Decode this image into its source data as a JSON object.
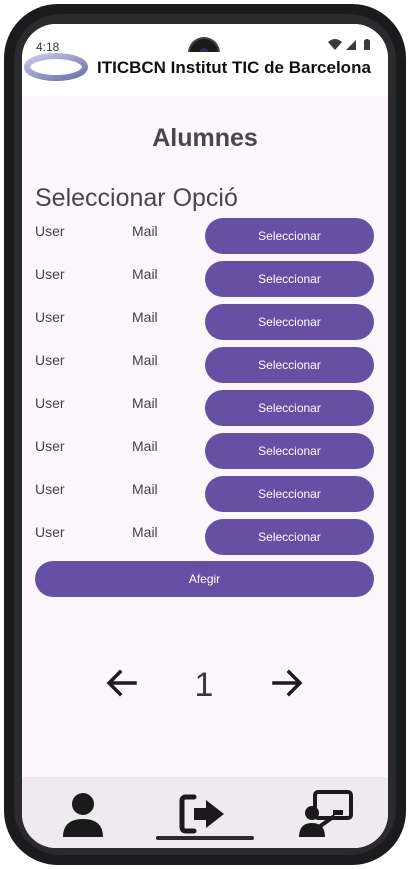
{
  "status_bar": {
    "time": "4:18",
    "icons": [
      "wifi-icon",
      "signal-icon",
      "battery-icon"
    ]
  },
  "header": {
    "title": "ITICBCN Institut TIC de Barcelona",
    "logo": "iticbcn-logo"
  },
  "page": {
    "title": "Alumnes",
    "section_title": "Seleccionar Opció"
  },
  "students": [
    {
      "user": "User",
      "mail": "Mail",
      "action": "Seleccionar"
    },
    {
      "user": "User",
      "mail": "Mail",
      "action": "Seleccionar"
    },
    {
      "user": "User",
      "mail": "Mail",
      "action": "Seleccionar"
    },
    {
      "user": "User",
      "mail": "Mail",
      "action": "Seleccionar"
    },
    {
      "user": "User",
      "mail": "Mail",
      "action": "Seleccionar"
    },
    {
      "user": "User",
      "mail": "Mail",
      "action": "Seleccionar"
    },
    {
      "user": "User",
      "mail": "Mail",
      "action": "Seleccionar"
    },
    {
      "user": "User",
      "mail": "Mail",
      "action": "Seleccionar"
    }
  ],
  "add_button": "Afegir",
  "pagination": {
    "current_page": "1",
    "prev_icon": "arrow-left-icon",
    "next_icon": "arrow-right-icon"
  },
  "bottom_nav": {
    "items": [
      "user-icon",
      "logout-icon",
      "presentation-icon"
    ]
  },
  "colors": {
    "primary": "#6750a4",
    "background": "#fdf6fd",
    "nav_background": "#eeeaf0"
  }
}
